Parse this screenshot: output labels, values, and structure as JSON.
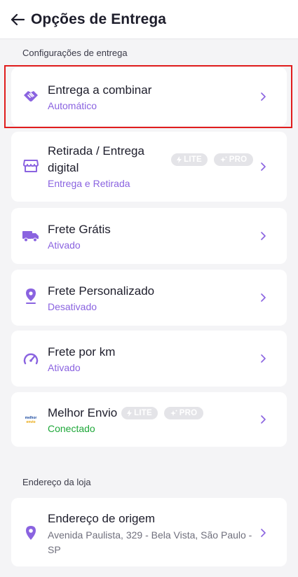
{
  "header": {
    "title": "Opções de Entrega"
  },
  "sections": {
    "delivery_settings": "Configurações de entrega",
    "store_address": "Endereço da loja"
  },
  "items": [
    {
      "title": "Entrega a combinar",
      "subtitle": "Automático",
      "icon": "handshake-icon"
    },
    {
      "title": "Retirada / Entrega digital",
      "subtitle": "Entrega e Retirada",
      "icon": "store-icon",
      "badges": [
        "LITE",
        "PRO"
      ]
    },
    {
      "title": "Frete Grátis",
      "subtitle": "Ativado",
      "icon": "truck-icon"
    },
    {
      "title": "Frete Personalizado",
      "subtitle": "Desativado",
      "icon": "map-pin-icon"
    },
    {
      "title": "Frete por km",
      "subtitle": "Ativado",
      "icon": "speedometer-icon"
    },
    {
      "title": "Melhor Envio",
      "subtitle": "Conectado",
      "icon": "melhor-envio-logo",
      "badges": [
        "LITE",
        "PRO"
      ]
    }
  ],
  "address": {
    "title": "Endereço de origem",
    "value": "Avenida Paulista, 329 - Bela Vista, São Paulo - SP",
    "icon": "location-icon"
  },
  "melhor_envio_logo_text": [
    "melhor",
    "envio"
  ],
  "colors": {
    "accent": "#8a63e0",
    "success": "#1fa83a",
    "highlight_border": "#e01d1d",
    "badge_bg": "#e4e4e8"
  }
}
